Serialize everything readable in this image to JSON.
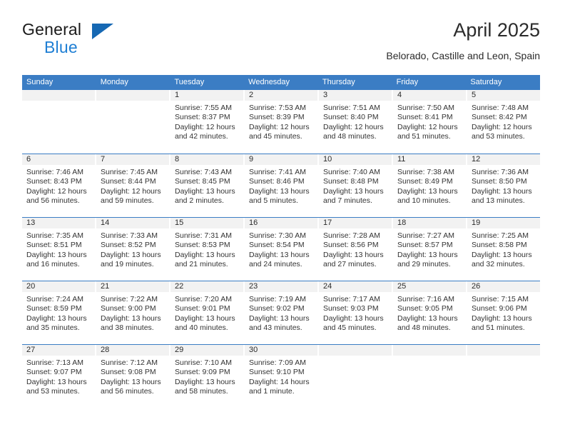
{
  "brand": {
    "name_top": "General",
    "name_bottom": "Blue",
    "accent_color": "#1f7fd4",
    "triangle_color": "#1668b3"
  },
  "header": {
    "title": "April 2025",
    "location": "Belorado, Castille and Leon, Spain"
  },
  "calendar": {
    "header_color": "#3b7dc4",
    "day_band_color": "#f2f2f2",
    "weekdays": [
      "Sunday",
      "Monday",
      "Tuesday",
      "Wednesday",
      "Thursday",
      "Friday",
      "Saturday"
    ],
    "weeks": [
      [
        {
          "day": "",
          "sunrise": "",
          "sunset": "",
          "daylight": "",
          "empty": true
        },
        {
          "day": "",
          "sunrise": "",
          "sunset": "",
          "daylight": "",
          "empty": true
        },
        {
          "day": "1",
          "sunrise": "Sunrise: 7:55 AM",
          "sunset": "Sunset: 8:37 PM",
          "daylight": "Daylight: 12 hours and 42 minutes."
        },
        {
          "day": "2",
          "sunrise": "Sunrise: 7:53 AM",
          "sunset": "Sunset: 8:39 PM",
          "daylight": "Daylight: 12 hours and 45 minutes."
        },
        {
          "day": "3",
          "sunrise": "Sunrise: 7:51 AM",
          "sunset": "Sunset: 8:40 PM",
          "daylight": "Daylight: 12 hours and 48 minutes."
        },
        {
          "day": "4",
          "sunrise": "Sunrise: 7:50 AM",
          "sunset": "Sunset: 8:41 PM",
          "daylight": "Daylight: 12 hours and 51 minutes."
        },
        {
          "day": "5",
          "sunrise": "Sunrise: 7:48 AM",
          "sunset": "Sunset: 8:42 PM",
          "daylight": "Daylight: 12 hours and 53 minutes."
        }
      ],
      [
        {
          "day": "6",
          "sunrise": "Sunrise: 7:46 AM",
          "sunset": "Sunset: 8:43 PM",
          "daylight": "Daylight: 12 hours and 56 minutes."
        },
        {
          "day": "7",
          "sunrise": "Sunrise: 7:45 AM",
          "sunset": "Sunset: 8:44 PM",
          "daylight": "Daylight: 12 hours and 59 minutes."
        },
        {
          "day": "8",
          "sunrise": "Sunrise: 7:43 AM",
          "sunset": "Sunset: 8:45 PM",
          "daylight": "Daylight: 13 hours and 2 minutes."
        },
        {
          "day": "9",
          "sunrise": "Sunrise: 7:41 AM",
          "sunset": "Sunset: 8:46 PM",
          "daylight": "Daylight: 13 hours and 5 minutes."
        },
        {
          "day": "10",
          "sunrise": "Sunrise: 7:40 AM",
          "sunset": "Sunset: 8:48 PM",
          "daylight": "Daylight: 13 hours and 7 minutes."
        },
        {
          "day": "11",
          "sunrise": "Sunrise: 7:38 AM",
          "sunset": "Sunset: 8:49 PM",
          "daylight": "Daylight: 13 hours and 10 minutes."
        },
        {
          "day": "12",
          "sunrise": "Sunrise: 7:36 AM",
          "sunset": "Sunset: 8:50 PM",
          "daylight": "Daylight: 13 hours and 13 minutes."
        }
      ],
      [
        {
          "day": "13",
          "sunrise": "Sunrise: 7:35 AM",
          "sunset": "Sunset: 8:51 PM",
          "daylight": "Daylight: 13 hours and 16 minutes."
        },
        {
          "day": "14",
          "sunrise": "Sunrise: 7:33 AM",
          "sunset": "Sunset: 8:52 PM",
          "daylight": "Daylight: 13 hours and 19 minutes."
        },
        {
          "day": "15",
          "sunrise": "Sunrise: 7:31 AM",
          "sunset": "Sunset: 8:53 PM",
          "daylight": "Daylight: 13 hours and 21 minutes."
        },
        {
          "day": "16",
          "sunrise": "Sunrise: 7:30 AM",
          "sunset": "Sunset: 8:54 PM",
          "daylight": "Daylight: 13 hours and 24 minutes."
        },
        {
          "day": "17",
          "sunrise": "Sunrise: 7:28 AM",
          "sunset": "Sunset: 8:56 PM",
          "daylight": "Daylight: 13 hours and 27 minutes."
        },
        {
          "day": "18",
          "sunrise": "Sunrise: 7:27 AM",
          "sunset": "Sunset: 8:57 PM",
          "daylight": "Daylight: 13 hours and 29 minutes."
        },
        {
          "day": "19",
          "sunrise": "Sunrise: 7:25 AM",
          "sunset": "Sunset: 8:58 PM",
          "daylight": "Daylight: 13 hours and 32 minutes."
        }
      ],
      [
        {
          "day": "20",
          "sunrise": "Sunrise: 7:24 AM",
          "sunset": "Sunset: 8:59 PM",
          "daylight": "Daylight: 13 hours and 35 minutes."
        },
        {
          "day": "21",
          "sunrise": "Sunrise: 7:22 AM",
          "sunset": "Sunset: 9:00 PM",
          "daylight": "Daylight: 13 hours and 38 minutes."
        },
        {
          "day": "22",
          "sunrise": "Sunrise: 7:20 AM",
          "sunset": "Sunset: 9:01 PM",
          "daylight": "Daylight: 13 hours and 40 minutes."
        },
        {
          "day": "23",
          "sunrise": "Sunrise: 7:19 AM",
          "sunset": "Sunset: 9:02 PM",
          "daylight": "Daylight: 13 hours and 43 minutes."
        },
        {
          "day": "24",
          "sunrise": "Sunrise: 7:17 AM",
          "sunset": "Sunset: 9:03 PM",
          "daylight": "Daylight: 13 hours and 45 minutes."
        },
        {
          "day": "25",
          "sunrise": "Sunrise: 7:16 AM",
          "sunset": "Sunset: 9:05 PM",
          "daylight": "Daylight: 13 hours and 48 minutes."
        },
        {
          "day": "26",
          "sunrise": "Sunrise: 7:15 AM",
          "sunset": "Sunset: 9:06 PM",
          "daylight": "Daylight: 13 hours and 51 minutes."
        }
      ],
      [
        {
          "day": "27",
          "sunrise": "Sunrise: 7:13 AM",
          "sunset": "Sunset: 9:07 PM",
          "daylight": "Daylight: 13 hours and 53 minutes."
        },
        {
          "day": "28",
          "sunrise": "Sunrise: 7:12 AM",
          "sunset": "Sunset: 9:08 PM",
          "daylight": "Daylight: 13 hours and 56 minutes."
        },
        {
          "day": "29",
          "sunrise": "Sunrise: 7:10 AM",
          "sunset": "Sunset: 9:09 PM",
          "daylight": "Daylight: 13 hours and 58 minutes."
        },
        {
          "day": "30",
          "sunrise": "Sunrise: 7:09 AM",
          "sunset": "Sunset: 9:10 PM",
          "daylight": "Daylight: 14 hours and 1 minute."
        },
        {
          "day": "",
          "sunrise": "",
          "sunset": "",
          "daylight": "",
          "empty": true
        },
        {
          "day": "",
          "sunrise": "",
          "sunset": "",
          "daylight": "",
          "empty": true
        },
        {
          "day": "",
          "sunrise": "",
          "sunset": "",
          "daylight": "",
          "empty": true
        }
      ]
    ]
  }
}
